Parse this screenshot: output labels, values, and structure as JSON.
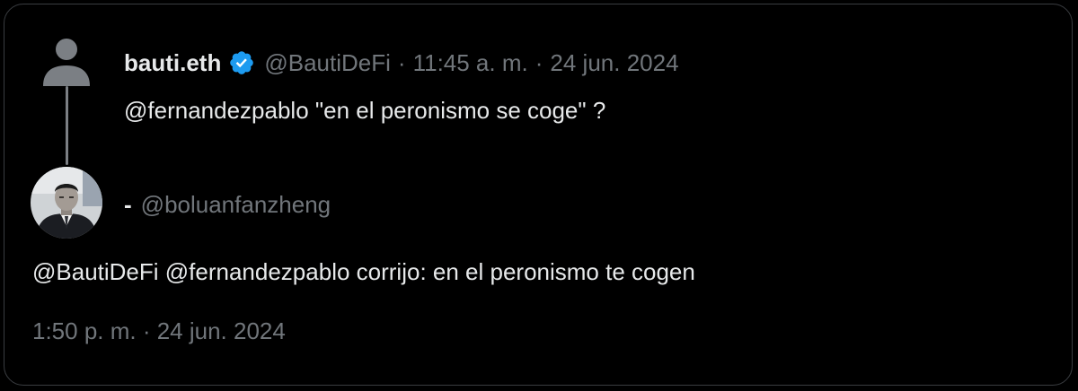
{
  "parent_tweet": {
    "display_name": "bauti.eth",
    "verified": true,
    "handle": "@BautiDeFi",
    "separator_1": "·",
    "time": "11:45 a. m.",
    "separator_2": "·",
    "date": "24 jun. 2024",
    "text": "@fernandezpablo \"en el peronismo se coge\" ?",
    "avatar_icon": "default-user-icon"
  },
  "reply_tweet": {
    "display_name": "-",
    "handle": "@boluanfanzheng",
    "text": "@BautiDeFi @fernandezpablo corrijo: en el peronismo te cogen",
    "timestamp": "1:50 p. m. · 24 jun. 2024",
    "avatar_icon": "profile-photo"
  },
  "colors": {
    "background": "#000000",
    "border": "#3a3d41",
    "primary_text": "#e7e9ea",
    "secondary_text": "#71767b",
    "verified_badge": "#1d9bf0",
    "thread_line": "#7b7f84"
  }
}
